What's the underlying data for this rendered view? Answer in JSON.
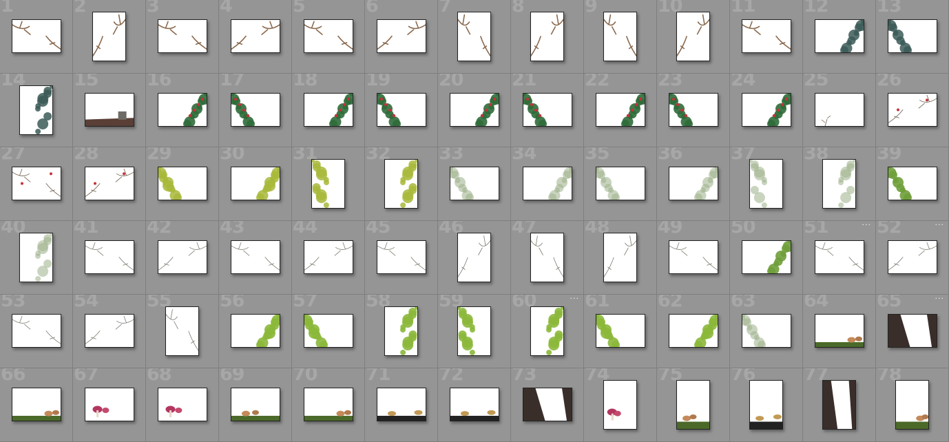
{
  "window": {
    "title": ""
  },
  "colors": {
    "background": "#959595",
    "cell_border": "#7e7e7e",
    "number": "#a7a7a7",
    "thumb_bg": "#ffffff",
    "thumb_border": "#222222"
  },
  "more_label": "···",
  "thumbnails": [
    {
      "number": "1",
      "orientation": "landscape",
      "content": "bare-branches",
      "more": false
    },
    {
      "number": "2",
      "orientation": "portrait",
      "content": "bare-branches",
      "more": false
    },
    {
      "number": "3",
      "orientation": "landscape",
      "content": "bare-branches",
      "more": false
    },
    {
      "number": "4",
      "orientation": "landscape",
      "content": "bare-branches",
      "more": false
    },
    {
      "number": "5",
      "orientation": "landscape",
      "content": "bare-branches",
      "more": false
    },
    {
      "number": "6",
      "orientation": "landscape",
      "content": "bare-branches",
      "more": false
    },
    {
      "number": "7",
      "orientation": "portrait",
      "content": "bare-branches",
      "more": false
    },
    {
      "number": "8",
      "orientation": "portrait",
      "content": "bare-branches",
      "more": false
    },
    {
      "number": "9",
      "orientation": "portrait",
      "content": "bare-branches",
      "more": false
    },
    {
      "number": "10",
      "orientation": "portrait",
      "content": "bare-branches",
      "more": false
    },
    {
      "number": "11",
      "orientation": "landscape",
      "content": "bare-branches",
      "more": false
    },
    {
      "number": "12",
      "orientation": "landscape",
      "content": "evergreen",
      "more": false
    },
    {
      "number": "13",
      "orientation": "landscape",
      "content": "evergreen",
      "more": false
    },
    {
      "number": "14",
      "orientation": "portrait",
      "content": "evergreen",
      "more": false
    },
    {
      "number": "15",
      "orientation": "landscape",
      "content": "roof",
      "more": false
    },
    {
      "number": "16",
      "orientation": "landscape",
      "content": "berries",
      "more": false
    },
    {
      "number": "17",
      "orientation": "landscape",
      "content": "berries",
      "more": false
    },
    {
      "number": "18",
      "orientation": "landscape",
      "content": "berries",
      "more": false
    },
    {
      "number": "19",
      "orientation": "landscape",
      "content": "berries",
      "more": false
    },
    {
      "number": "20",
      "orientation": "landscape",
      "content": "berries",
      "more": false
    },
    {
      "number": "21",
      "orientation": "landscape",
      "content": "berries",
      "more": false
    },
    {
      "number": "22",
      "orientation": "landscape",
      "content": "berries",
      "more": false
    },
    {
      "number": "23",
      "orientation": "landscape",
      "content": "berries",
      "more": false
    },
    {
      "number": "24",
      "orientation": "landscape",
      "content": "berries",
      "more": false
    },
    {
      "number": "25",
      "orientation": "landscape",
      "content": "small-twig",
      "more": false
    },
    {
      "number": "26",
      "orientation": "landscape",
      "content": "berry-twig",
      "more": false
    },
    {
      "number": "27",
      "orientation": "landscape",
      "content": "berry-twig",
      "more": false
    },
    {
      "number": "28",
      "orientation": "landscape",
      "content": "berry-twig",
      "more": false
    },
    {
      "number": "29",
      "orientation": "landscape",
      "content": "yellow-foliage",
      "more": false
    },
    {
      "number": "30",
      "orientation": "landscape",
      "content": "yellow-foliage",
      "more": false
    },
    {
      "number": "31",
      "orientation": "portrait",
      "content": "yellow-foliage",
      "more": false
    },
    {
      "number": "32",
      "orientation": "portrait",
      "content": "yellow-foliage",
      "more": false
    },
    {
      "number": "33",
      "orientation": "landscape",
      "content": "pale-foliage",
      "more": false
    },
    {
      "number": "34",
      "orientation": "landscape",
      "content": "pale-foliage",
      "more": false
    },
    {
      "number": "35",
      "orientation": "landscape",
      "content": "pale-foliage",
      "more": false
    },
    {
      "number": "36",
      "orientation": "landscape",
      "content": "pale-foliage",
      "more": false
    },
    {
      "number": "37",
      "orientation": "portrait",
      "content": "pale-foliage",
      "more": false
    },
    {
      "number": "38",
      "orientation": "portrait",
      "content": "pale-foliage",
      "more": false
    },
    {
      "number": "39",
      "orientation": "landscape",
      "content": "green-foliage",
      "more": false
    },
    {
      "number": "40",
      "orientation": "portrait",
      "content": "pale-foliage",
      "more": false
    },
    {
      "number": "41",
      "orientation": "landscape",
      "content": "thin-twigs",
      "more": false
    },
    {
      "number": "42",
      "orientation": "landscape",
      "content": "thin-twigs",
      "more": false
    },
    {
      "number": "43",
      "orientation": "landscape",
      "content": "thin-twigs",
      "more": false
    },
    {
      "number": "44",
      "orientation": "landscape",
      "content": "thin-twigs",
      "more": false
    },
    {
      "number": "45",
      "orientation": "landscape",
      "content": "thin-twigs",
      "more": false
    },
    {
      "number": "46",
      "orientation": "portrait",
      "content": "thin-twigs",
      "more": false
    },
    {
      "number": "47",
      "orientation": "portrait",
      "content": "thin-twigs",
      "more": false
    },
    {
      "number": "48",
      "orientation": "portrait",
      "content": "thin-twigs",
      "more": false
    },
    {
      "number": "49",
      "orientation": "landscape",
      "content": "thin-twigs",
      "more": false
    },
    {
      "number": "50",
      "orientation": "landscape",
      "content": "green-foliage",
      "more": false
    },
    {
      "number": "51",
      "orientation": "landscape",
      "content": "thin-twigs",
      "more": true
    },
    {
      "number": "52",
      "orientation": "landscape",
      "content": "thin-twigs",
      "more": true
    },
    {
      "number": "53",
      "orientation": "landscape",
      "content": "thin-twigs",
      "more": false
    },
    {
      "number": "54",
      "orientation": "landscape",
      "content": "thin-twigs",
      "more": false
    },
    {
      "number": "55",
      "orientation": "portrait",
      "content": "thin-twigs",
      "more": false
    },
    {
      "number": "56",
      "orientation": "landscape",
      "content": "green-leaves",
      "more": false
    },
    {
      "number": "57",
      "orientation": "landscape",
      "content": "green-leaves",
      "more": false
    },
    {
      "number": "58",
      "orientation": "portrait",
      "content": "green-leaves",
      "more": false
    },
    {
      "number": "59",
      "orientation": "portrait",
      "content": "green-leaves",
      "more": false
    },
    {
      "number": "60",
      "orientation": "portrait",
      "content": "green-leaves",
      "more": true
    },
    {
      "number": "61",
      "orientation": "landscape",
      "content": "green-leaves",
      "more": false
    },
    {
      "number": "62",
      "orientation": "landscape",
      "content": "green-leaves",
      "more": false
    },
    {
      "number": "63",
      "orientation": "landscape",
      "content": "pale-foliage",
      "more": false
    },
    {
      "number": "64",
      "orientation": "landscape",
      "content": "mushrooms",
      "more": false
    },
    {
      "number": "65",
      "orientation": "landscape",
      "content": "bark",
      "more": true
    },
    {
      "number": "66",
      "orientation": "landscape",
      "content": "mushrooms",
      "more": false
    },
    {
      "number": "67",
      "orientation": "landscape",
      "content": "red-mushrooms",
      "more": false
    },
    {
      "number": "68",
      "orientation": "landscape",
      "content": "red-mushrooms",
      "more": false
    },
    {
      "number": "69",
      "orientation": "landscape",
      "content": "mushrooms",
      "more": false
    },
    {
      "number": "70",
      "orientation": "landscape",
      "content": "mushrooms",
      "more": false
    },
    {
      "number": "71",
      "orientation": "landscape",
      "content": "dark-mushrooms",
      "more": false
    },
    {
      "number": "72",
      "orientation": "landscape",
      "content": "dark-mushrooms",
      "more": false
    },
    {
      "number": "73",
      "orientation": "landscape",
      "content": "bark",
      "more": false
    },
    {
      "number": "74",
      "orientation": "portrait",
      "content": "red-mushrooms",
      "more": false
    },
    {
      "number": "75",
      "orientation": "portrait",
      "content": "mushrooms",
      "more": false
    },
    {
      "number": "76",
      "orientation": "portrait",
      "content": "dark-mushrooms",
      "more": false
    },
    {
      "number": "77",
      "orientation": "portrait",
      "content": "bark",
      "more": false
    },
    {
      "number": "78",
      "orientation": "portrait",
      "content": "mushrooms",
      "more": false
    }
  ]
}
